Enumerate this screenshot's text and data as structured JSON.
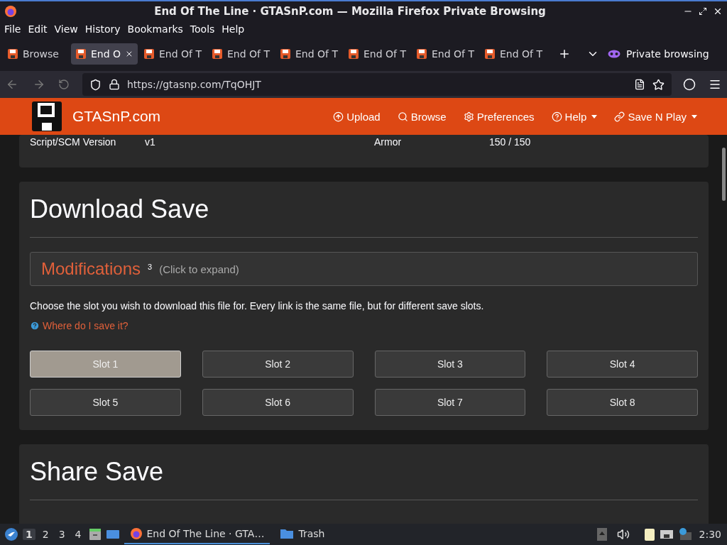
{
  "window": {
    "title": "End Of The Line · GTASnP.com — Mozilla Firefox Private Browsing"
  },
  "menu": [
    "File",
    "Edit",
    "View",
    "History",
    "Bookmarks",
    "Tools",
    "Help"
  ],
  "tabs": [
    {
      "label": "Browse",
      "selected": false
    },
    {
      "label": "End O",
      "selected": true
    },
    {
      "label": "End Of T",
      "selected": false
    },
    {
      "label": "End Of T",
      "selected": false
    },
    {
      "label": "End Of T",
      "selected": false
    },
    {
      "label": "End Of T",
      "selected": false
    },
    {
      "label": "End Of T",
      "selected": false
    },
    {
      "label": "End Of T",
      "selected": false
    }
  ],
  "private_label": "Private browsing",
  "url": "https://gtasnp.com/TqOHJT",
  "site": {
    "name": "GTASnP.com",
    "nav": [
      {
        "label": "Upload",
        "kind": "upload",
        "dropdown": false
      },
      {
        "label": "Browse",
        "kind": "search",
        "dropdown": false
      },
      {
        "label": "Preferences",
        "kind": "gear",
        "dropdown": false
      },
      {
        "label": "Help",
        "kind": "help",
        "dropdown": true
      },
      {
        "label": "Save N Play",
        "kind": "link",
        "dropdown": true
      }
    ]
  },
  "info": [
    {
      "label": "Script/SCM Version",
      "value": "v1"
    },
    {
      "label": "Armor",
      "value": "150 / 150"
    }
  ],
  "download": {
    "title": "Download Save",
    "modifications": {
      "title": "Modifications",
      "count": "3",
      "hint": "(Click to expand)"
    },
    "text": "Choose the slot you wish to download this file for. Every link is the same file, but for different save slots.",
    "help_link": "Where do I save it?",
    "slots": [
      {
        "label": "Slot 1",
        "selected": true
      },
      {
        "label": "Slot 2",
        "selected": false
      },
      {
        "label": "Slot 3",
        "selected": false
      },
      {
        "label": "Slot 4",
        "selected": false
      },
      {
        "label": "Slot 5",
        "selected": false
      },
      {
        "label": "Slot 6",
        "selected": false
      },
      {
        "label": "Slot 7",
        "selected": false
      },
      {
        "label": "Slot 8",
        "selected": false
      }
    ]
  },
  "share": {
    "title": "Share Save"
  },
  "taskbar": {
    "workspaces": [
      {
        "label": "1",
        "selected": true
      },
      {
        "label": "2",
        "selected": false
      },
      {
        "label": "3",
        "selected": false
      },
      {
        "label": "4",
        "selected": false
      }
    ],
    "apps": [
      {
        "label": "End Of The Line · GTA…",
        "kind": "firefox",
        "selected": true
      },
      {
        "label": "Trash",
        "kind": "folder",
        "selected": false
      }
    ],
    "clock": "2:30"
  }
}
